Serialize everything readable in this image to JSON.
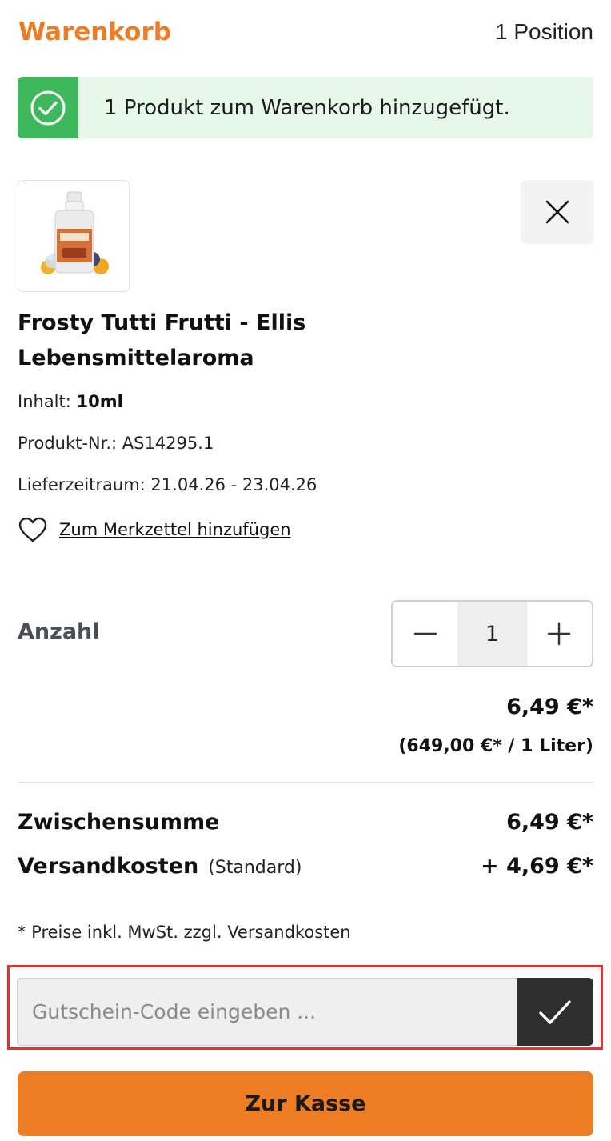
{
  "header": {
    "title": "Warenkorb",
    "position_count": "1 Position"
  },
  "alert": {
    "message": "1 Produkt zum Warenkorb hinzugefügt.",
    "icon": "check-circle-icon",
    "color": "#3eb75d"
  },
  "product": {
    "image_icon": "product-bottle-image",
    "name": "Frosty Tutti Frutti - Ellis Lebensmittelaroma",
    "content_label": "Inhalt:",
    "content_value": "10ml",
    "product_number": "Produkt-Nr.: AS14295.1",
    "delivery": "Lieferzeitraum: 21.04.26 - 23.04.26",
    "wishlist_label": "Zum Merkzettel hinzufügen",
    "remove_icon": "close-icon"
  },
  "quantity": {
    "label": "Anzahl",
    "value": "1"
  },
  "pricing": {
    "price": "6,49 €*",
    "unit_price": "(649,00 €* / 1 Liter)"
  },
  "summary": {
    "subtotal_label": "Zwischensumme",
    "subtotal_value": "6,49 €*",
    "shipping_label": "Versandkosten",
    "shipping_method": "(Standard)",
    "shipping_value": "+ 4,69 €*"
  },
  "tax_note": "* Preise inkl. MwSt. zzgl. Versandkosten",
  "voucher": {
    "placeholder": "Gutschein-Code eingeben ...",
    "value": ""
  },
  "checkout": {
    "label": "Zur Kasse"
  },
  "colors": {
    "accent": "#ed7d24",
    "success": "#3eb75d",
    "success_bg": "#e7f8ea",
    "highlight": "#e53030"
  }
}
